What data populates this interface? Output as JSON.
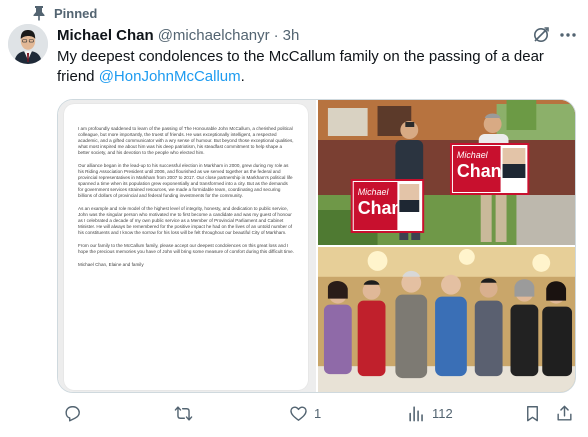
{
  "pinned": {
    "label": "Pinned",
    "icon": "pin-icon"
  },
  "author": {
    "display_name": "Michael Chan",
    "handle": "@michaelchanyr",
    "separator": "·",
    "timestamp": "3h",
    "avatar_icon": "avatar"
  },
  "tweet": {
    "text_before": "My deepest condolences to the McCallum family on the passing of a dear friend ",
    "mention": "@HonJohnMcCallum",
    "text_after": "."
  },
  "media": {
    "letter": {
      "paragraphs": [
        "I am profoundly saddened to learn of the passing of The Honourable John McCallum, a cherished political colleague, but more importantly, the truest of friends. He was exceptionally intelligent, a respected academic, and a gifted communicator with a wry sense of humour. But beyond those exceptional qualities, what most inspired me about him was his deep patriotism, his steadfast commitment to help shape a better society, and his devotion to the people who elected him.",
        "Our alliance began in the lead-up to his successful election in Markham in 2000, grew during my role as his Riding Association President until 2006, and flourished as we served together as the federal and provincial representatives in Markham from 2007 to 2017. Our close partnership in Markham's political life spanned a time when its population grew exponentially and transformed into a city. But as the demands for government services strained resources, we made a formidable team, coordinating and securing billions of dollars of provincial and federal funding investments for the community.",
        "As an example and role model of the highest level of integrity, honesty, and dedication to public service, John was the singular person who motivated me to first become a candidate and was my guest of honour as I celebrated a decade of my own public service as a Member of Provincial Parliament and Cabinet Minister. He will always be remembered for the positive impact he had on the lives of an untold number of his constituents and I know the sorrow for his loss will be felt throughout our beautiful City of Markham.",
        "From our family to the McCallum family, please accept our deepest condolences on this great loss and I hope the precious memories you have of John will bring some measure of comfort during this difficult time.",
        "Michael Chan, Elaine and family"
      ]
    },
    "sign": {
      "line1": "Michael",
      "line2": "Chan"
    }
  },
  "actions": {
    "reply": {
      "icon": "reply-icon",
      "count": ""
    },
    "retweet": {
      "icon": "retweet-icon",
      "count": ""
    },
    "like": {
      "icon": "heart-icon",
      "count": "1"
    },
    "views": {
      "icon": "views-icon",
      "count": "112"
    },
    "bookmark": {
      "icon": "bookmark-icon"
    },
    "share": {
      "icon": "share-icon"
    }
  },
  "colors": {
    "text": "#0f1419",
    "muted": "#536471",
    "link": "#1d9bf0",
    "sign_red": "#c8102e"
  }
}
